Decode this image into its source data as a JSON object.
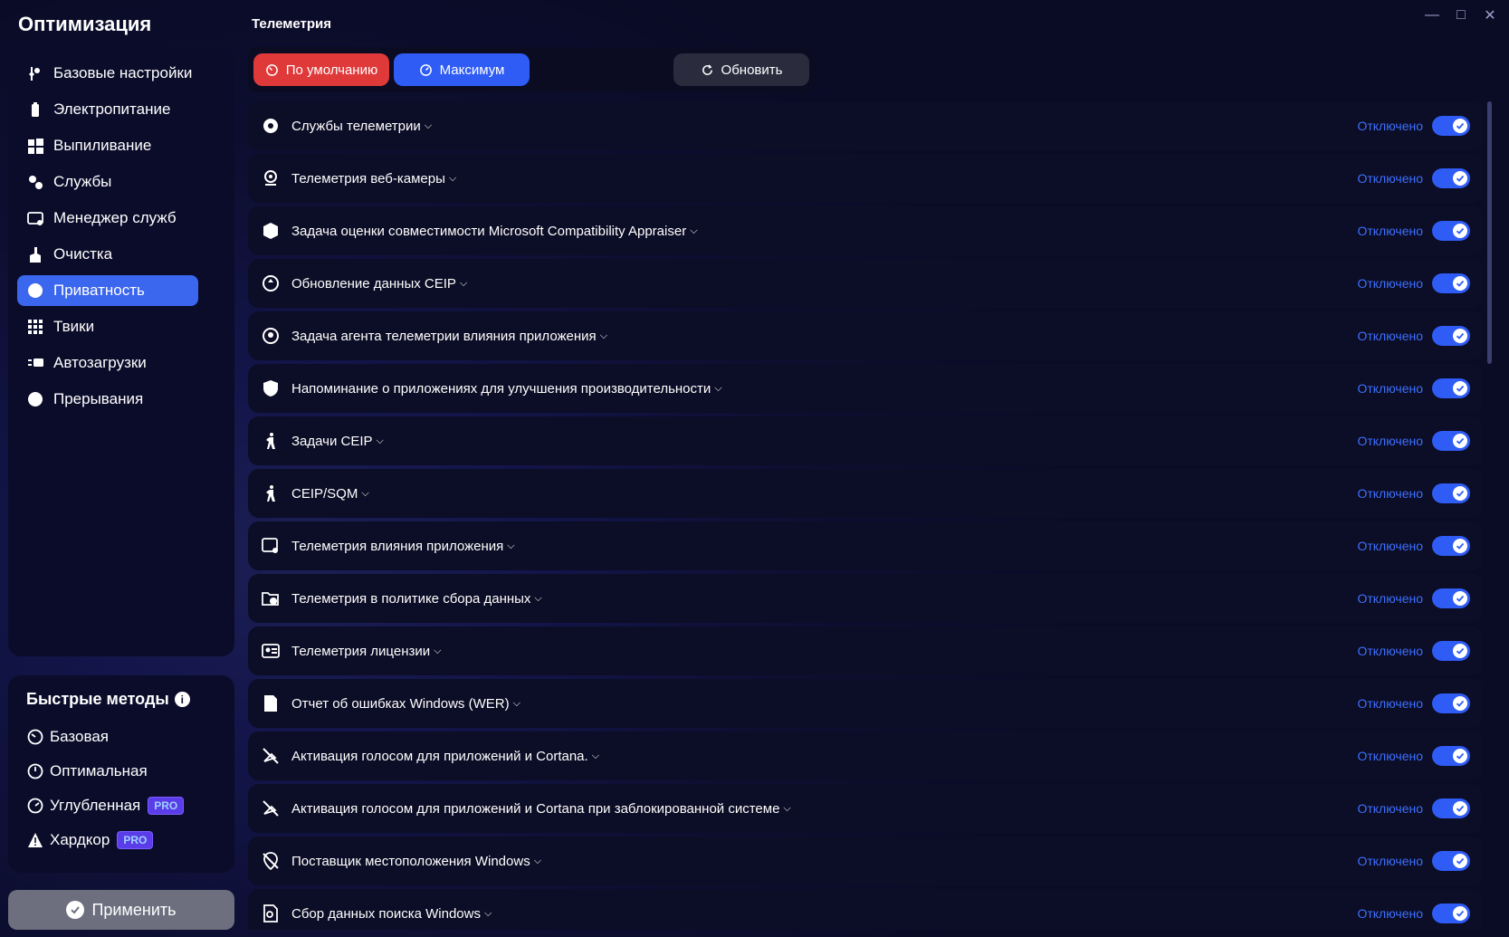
{
  "app": {
    "title": "Оптимизация"
  },
  "sidebar": {
    "items": [
      {
        "label": "Базовые настройки",
        "icon": "tools-icon",
        "active": false
      },
      {
        "label": "Электропитание",
        "icon": "battery-icon",
        "active": false
      },
      {
        "label": "Выпиливание",
        "icon": "windows-icon",
        "active": false
      },
      {
        "label": "Службы",
        "icon": "gears-icon",
        "active": false
      },
      {
        "label": "Менеджер служб",
        "icon": "window-gear-icon",
        "active": false
      },
      {
        "label": "Очистка",
        "icon": "broom-icon",
        "active": false
      },
      {
        "label": "Приватность",
        "icon": "privacy-icon",
        "active": true
      },
      {
        "label": "Твики",
        "icon": "grid-icon",
        "active": false
      },
      {
        "label": "Автозагрузки",
        "icon": "startup-icon",
        "active": false
      },
      {
        "label": "Прерывания",
        "icon": "interrupt-icon",
        "active": false
      }
    ]
  },
  "quick": {
    "title": "Быстрые методы",
    "info_icon": "i",
    "items": [
      {
        "label": "Базовая",
        "icon": "gauge-low-icon",
        "pro": ""
      },
      {
        "label": "Оптимальная",
        "icon": "gauge-mid-icon",
        "pro": ""
      },
      {
        "label": "Углубленная",
        "icon": "gauge-high-icon",
        "pro": "PRO"
      },
      {
        "label": "Хардкор",
        "icon": "warning-icon",
        "pro": "PRO"
      }
    ]
  },
  "apply": {
    "label": "Применить"
  },
  "main": {
    "title": "Телеметрия",
    "presets": {
      "default": "По умолчанию",
      "max": "Максимум",
      "refresh": "Обновить"
    },
    "status_off": "Отключено",
    "rows": [
      {
        "label": "Службы телеметрии",
        "icon": "gear-icon"
      },
      {
        "label": "Телеметрия веб-камеры",
        "icon": "webcam-icon"
      },
      {
        "label": "Задача оценки совместимости Microsoft Compatibility Appraiser",
        "icon": "box-icon"
      },
      {
        "label": "Обновление данных CEIP",
        "icon": "refresh-circle-icon"
      },
      {
        "label": "Задача агента телеметрии влияния приложения",
        "icon": "agent-icon"
      },
      {
        "label": "Напоминание о приложениях для улучшения производительности",
        "icon": "shield-icon"
      },
      {
        "label": "Задачи CEIP",
        "icon": "walking-icon"
      },
      {
        "label": "CEIP/SQM",
        "icon": "walking-icon"
      },
      {
        "label": "Телеметрия влияния приложения",
        "icon": "window-settings-icon"
      },
      {
        "label": "Телеметрия в политике сбора данных",
        "icon": "folder-clock-icon"
      },
      {
        "label": "Телеметрия лицензии",
        "icon": "id-card-icon"
      },
      {
        "label": "Отчет об ошибках Windows (WER)",
        "icon": "report-icon"
      },
      {
        "label": "Активация голосом для приложений и Cortana.",
        "icon": "voice-off-icon"
      },
      {
        "label": "Активация голосом для приложений и Cortana при заблокированной системе",
        "icon": "voice-off-icon"
      },
      {
        "label": "Поставщик местоположения Windows",
        "icon": "location-off-icon"
      },
      {
        "label": "Сбор данных поиска Windows",
        "icon": "search-doc-icon"
      }
    ]
  }
}
